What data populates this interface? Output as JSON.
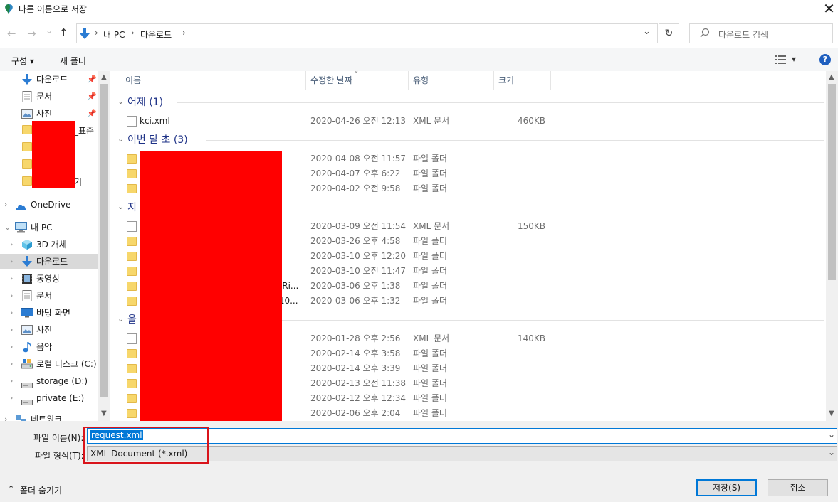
{
  "window": {
    "title": "다른 이름으로 저장",
    "close_glyph": "✕"
  },
  "nav": {
    "back": "←",
    "forward": "→",
    "recent": "⌄",
    "up": "↑"
  },
  "address": {
    "parts": [
      "내 PC",
      "다운로드"
    ],
    "sep": "›",
    "dropdown": "⌄",
    "refresh": "↻"
  },
  "search": {
    "placeholder": "다운로드 검색"
  },
  "toolbar": {
    "organize": "구성 ▾",
    "new_folder": "새 폴더",
    "view": "▾",
    "help": "?"
  },
  "sidebar": {
    "quick": [
      {
        "label": "다운로드",
        "icon": "download-icon",
        "pinned": true
      },
      {
        "label": "문서",
        "icon": "document-icon",
        "pinned": true
      },
      {
        "label": "사진",
        "icon": "picture-icon",
        "pinned": true
      },
      {
        "label": "_표준",
        "icon": "folder-icon"
      },
      {
        "label": "",
        "icon": "folder-icon"
      },
      {
        "label": "",
        "icon": "folder-icon"
      },
      {
        "label": "기",
        "icon": "folder-icon"
      }
    ],
    "onedrive": "OneDrive",
    "this_pc": "내 PC",
    "pc_items": [
      {
        "label": "3D 개체",
        "icon": "3d-icon"
      },
      {
        "label": "다운로드",
        "icon": "download-icon",
        "selected": true
      },
      {
        "label": "동영상",
        "icon": "video-icon"
      },
      {
        "label": "문서",
        "icon": "document-icon"
      },
      {
        "label": "바탕 화면",
        "icon": "desktop-icon"
      },
      {
        "label": "사진",
        "icon": "picture-icon"
      },
      {
        "label": "음악",
        "icon": "music-icon"
      },
      {
        "label": "로컬 디스크 (C:)",
        "icon": "disk-icon"
      },
      {
        "label": "storage (D:)",
        "icon": "drive-icon"
      },
      {
        "label": "private (E:)",
        "icon": "drive-icon"
      },
      {
        "label": "네트워크",
        "icon": "network-icon"
      }
    ]
  },
  "columns": {
    "name": "이름",
    "modified": "수정한 날짜",
    "type": "유형",
    "size": "크기"
  },
  "groups": [
    {
      "label": "어제 (1)",
      "rows": [
        {
          "name": "kci.xml",
          "date": "2020-04-26 오전 12:13",
          "type": "XML 문서",
          "size": "460KB",
          "kind": "file"
        }
      ]
    },
    {
      "label": "이번 달 초 (3)",
      "rows": [
        {
          "name": "",
          "date": "2020-04-08 오전 11:57",
          "type": "파일 폴더",
          "size": "",
          "kind": "folder"
        },
        {
          "name": "",
          "date": "2020-04-07 오후 6:22",
          "type": "파일 폴더",
          "size": "",
          "kind": "folder"
        },
        {
          "name": "",
          "date": "2020-04-02 오전 9:58",
          "type": "파일 폴더",
          "size": "",
          "kind": "folder"
        }
      ]
    },
    {
      "label": "지",
      "rows": [
        {
          "name": "",
          "date": "2020-03-09 오전 11:54",
          "type": "XML 문서",
          "size": "150KB",
          "kind": "file"
        },
        {
          "name": "",
          "date": "2020-03-26 오후 4:58",
          "type": "파일 폴더",
          "size": "",
          "kind": "folder"
        },
        {
          "name": "",
          "date": "2020-03-10 오후 12:20",
          "type": "파일 폴더",
          "size": "",
          "kind": "folder"
        },
        {
          "name": "",
          "date": "2020-03-10 오전 11:47",
          "type": "파일 폴더",
          "size": "",
          "kind": "folder"
        },
        {
          "name": "BRi...",
          "date": "2020-03-06 오후 1:38",
          "type": "파일 폴더",
          "size": "",
          "kind": "folder"
        },
        {
          "name": ".10...",
          "date": "2020-03-06 오후 1:32",
          "type": "파일 폴더",
          "size": "",
          "kind": "folder"
        }
      ]
    },
    {
      "label": "올",
      "rows": [
        {
          "name": "",
          "date": "2020-01-28 오후 2:56",
          "type": "XML 문서",
          "size": "140KB",
          "kind": "file"
        },
        {
          "name": "",
          "date": "2020-02-14 오후 3:58",
          "type": "파일 폴더",
          "size": "",
          "kind": "folder"
        },
        {
          "name": "",
          "date": "2020-02-14 오후 3:39",
          "type": "파일 폴더",
          "size": "",
          "kind": "folder"
        },
        {
          "name": "",
          "date": "2020-02-13 오전 11:38",
          "type": "파일 폴더",
          "size": "",
          "kind": "folder"
        },
        {
          "name": "",
          "date": "2020-02-12 오후 12:34",
          "type": "파일 폴더",
          "size": "",
          "kind": "folder"
        },
        {
          "name": "",
          "date": "2020-02-06 오후 2:04",
          "type": "파일 폴더",
          "size": "",
          "kind": "folder"
        }
      ]
    }
  ],
  "save": {
    "filename_label": "파일 이름(N):",
    "filename_value": "request.xml",
    "filetype_label": "파일 형식(T):",
    "filetype_value": "XML Document (*.xml)",
    "dropdown": "⌄",
    "hide_folders": "폴더 숨기기",
    "hide_chev": "⌃",
    "save_button": "저장(S)",
    "cancel_button": "취소"
  },
  "colors": {
    "redaction": "#ff0000",
    "accent": "#0078d7",
    "selected_bg": "#d9d9d9"
  }
}
